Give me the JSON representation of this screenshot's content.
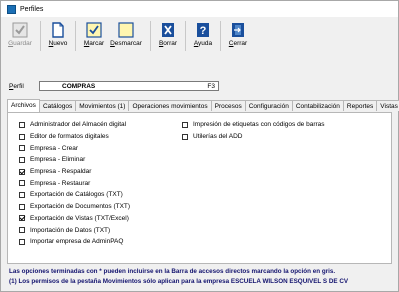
{
  "window": {
    "title": "Perfiles"
  },
  "toolbar": {
    "buttons": [
      {
        "label": "Guardar",
        "accel": "G",
        "rest": "uardar",
        "icon": "save-check-icon",
        "enabled": false
      },
      {
        "label": "Nuevo",
        "accel": "N",
        "rest": "uevo",
        "icon": "new-document-icon",
        "enabled": true
      },
      {
        "label": "Marcar",
        "accel": "M",
        "rest": "arcar",
        "icon": "mark-checkbox-icon",
        "enabled": true
      },
      {
        "label": "Desmarcar",
        "accel": "D",
        "rest": "esmarcar",
        "icon": "unmark-checkbox-icon",
        "enabled": true
      },
      {
        "label": "Borrar",
        "accel": "B",
        "rest": "orrar",
        "icon": "delete-icon",
        "enabled": true
      },
      {
        "label": "Ayuda",
        "accel": "A",
        "rest": "yuda",
        "icon": "help-icon",
        "enabled": true
      },
      {
        "label": "Cerrar",
        "accel": "C",
        "rest": "errar",
        "icon": "close-door-icon",
        "enabled": true
      }
    ]
  },
  "profile": {
    "label_accel": "P",
    "label_rest": "erfil",
    "value": "COMPRAS",
    "shortcut": "F3"
  },
  "tabs": [
    {
      "label": "Archivos",
      "active": true
    },
    {
      "label": "Catálogos",
      "active": false
    },
    {
      "label": "Movimientos (1)",
      "active": false
    },
    {
      "label": "Operaciones movimientos",
      "active": false
    },
    {
      "label": "Procesos",
      "active": false
    },
    {
      "label": "Configuración",
      "active": false
    },
    {
      "label": "Contabilización",
      "active": false
    },
    {
      "label": "Reportes",
      "active": false
    },
    {
      "label": "Vistas",
      "active": false
    }
  ],
  "permissions_left": [
    {
      "label": "Administrador del Almacén digital",
      "checked": false
    },
    {
      "label": "Editor de formatos digitales",
      "checked": false
    },
    {
      "label": "Empresa - Crear",
      "checked": false
    },
    {
      "label": "Empresa - Eliminar",
      "checked": false
    },
    {
      "label": "Empresa - Respaldar",
      "checked": true
    },
    {
      "label": "Empresa - Restaurar",
      "checked": false
    },
    {
      "label": "Exportación de Catálogos (TXT)",
      "checked": false
    },
    {
      "label": "Exportación de Documentos (TXT)",
      "checked": false
    },
    {
      "label": "Exportación de Vistas (TXT/Excel)",
      "checked": true
    },
    {
      "label": "Importación de Datos (TXT)",
      "checked": false
    },
    {
      "label": "Importar empresa de AdminPAQ",
      "checked": false
    }
  ],
  "permissions_right": [
    {
      "label": "Impresión de etiquetas con códigos de barras",
      "checked": false
    },
    {
      "label": "Utilerías del ADD",
      "checked": false
    }
  ],
  "notes": {
    "line1": "Las opciones terminadas con * pueden incluirse en la Barra de accesos directos marcando la opción en gris.",
    "line2": "(1) Los permisos de la pestaña Movimientos sólo aplican para la empresa ESCUELA WILSON ESQUIVEL S DE CV"
  }
}
